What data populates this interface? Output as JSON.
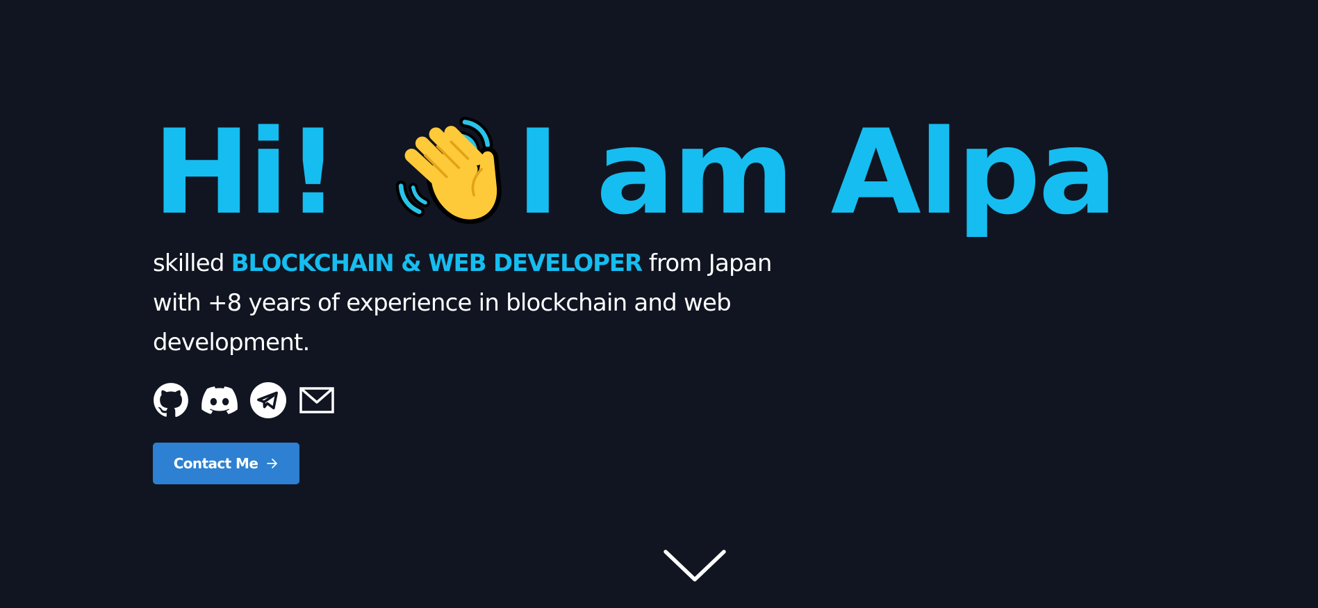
{
  "hero": {
    "greeting": "Hi!",
    "wave_emoji": "waving-hand-icon",
    "intro": "I am Alpa",
    "tagline": {
      "prefix": "skilled ",
      "role": "BLOCKCHAIN & WEB DEVELOPER",
      "suffix": " from Japan with +8 years of experience in blockchain and web development."
    }
  },
  "socials": [
    {
      "name": "github",
      "icon": "github-icon"
    },
    {
      "name": "discord",
      "icon": "discord-icon"
    },
    {
      "name": "telegram",
      "icon": "telegram-icon"
    },
    {
      "name": "email",
      "icon": "mail-icon"
    }
  ],
  "cta": {
    "label": "Contact Me",
    "icon": "arrow-right-icon"
  },
  "scroll_indicator": {
    "icon": "chevron-down-icon"
  },
  "colors": {
    "background": "#111521",
    "accent": "#16bdf0",
    "button": "#2d80d2",
    "text": "#ffffff"
  }
}
